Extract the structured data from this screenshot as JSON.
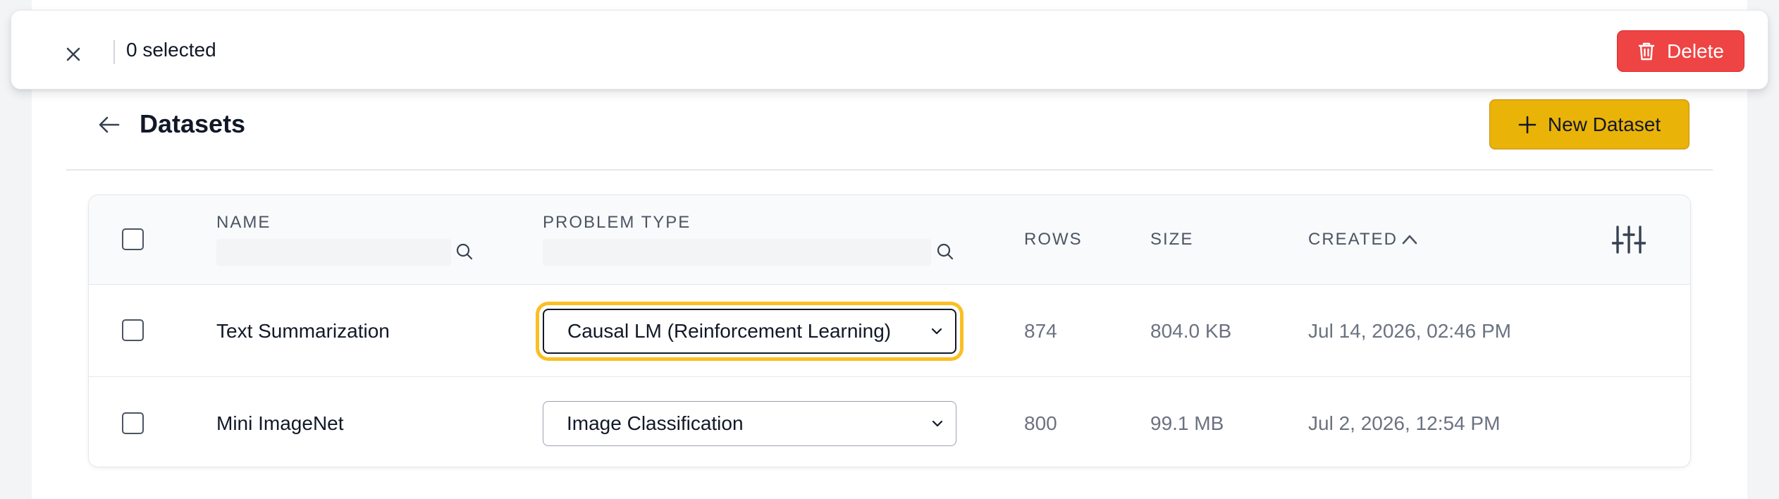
{
  "selection_bar": {
    "count_label": "0 selected",
    "delete_label": "Delete"
  },
  "header": {
    "title": "Datasets",
    "new_dataset_label": "New Dataset"
  },
  "table": {
    "columns": {
      "name": "NAME",
      "problem_type": "PROBLEM TYPE",
      "rows": "ROWS",
      "size": "SIZE",
      "created": "CREATED"
    },
    "rows": [
      {
        "name": "Text Summarization",
        "problem_type": "Causal LM (Reinforcement Learning)",
        "rows": "874",
        "size": "804.0 KB",
        "created": "Jul 14, 2026, 02:46 PM"
      },
      {
        "name": "Mini ImageNet",
        "problem_type": "Image Classification",
        "rows": "800",
        "size": "99.1 MB",
        "created": "Jul 2, 2026, 12:54 PM"
      }
    ]
  },
  "colors": {
    "delete": "#ef4444",
    "primary": "#eab308",
    "focus_ring": "#fbbf24"
  },
  "icons": {
    "close": "close-icon",
    "delete": "trash-icon",
    "back": "arrow-left-icon",
    "add": "plus-icon",
    "search": "search-icon",
    "sort": "chevron-up-icon",
    "columns": "sliders-icon",
    "select": "chevron-down-icon"
  }
}
